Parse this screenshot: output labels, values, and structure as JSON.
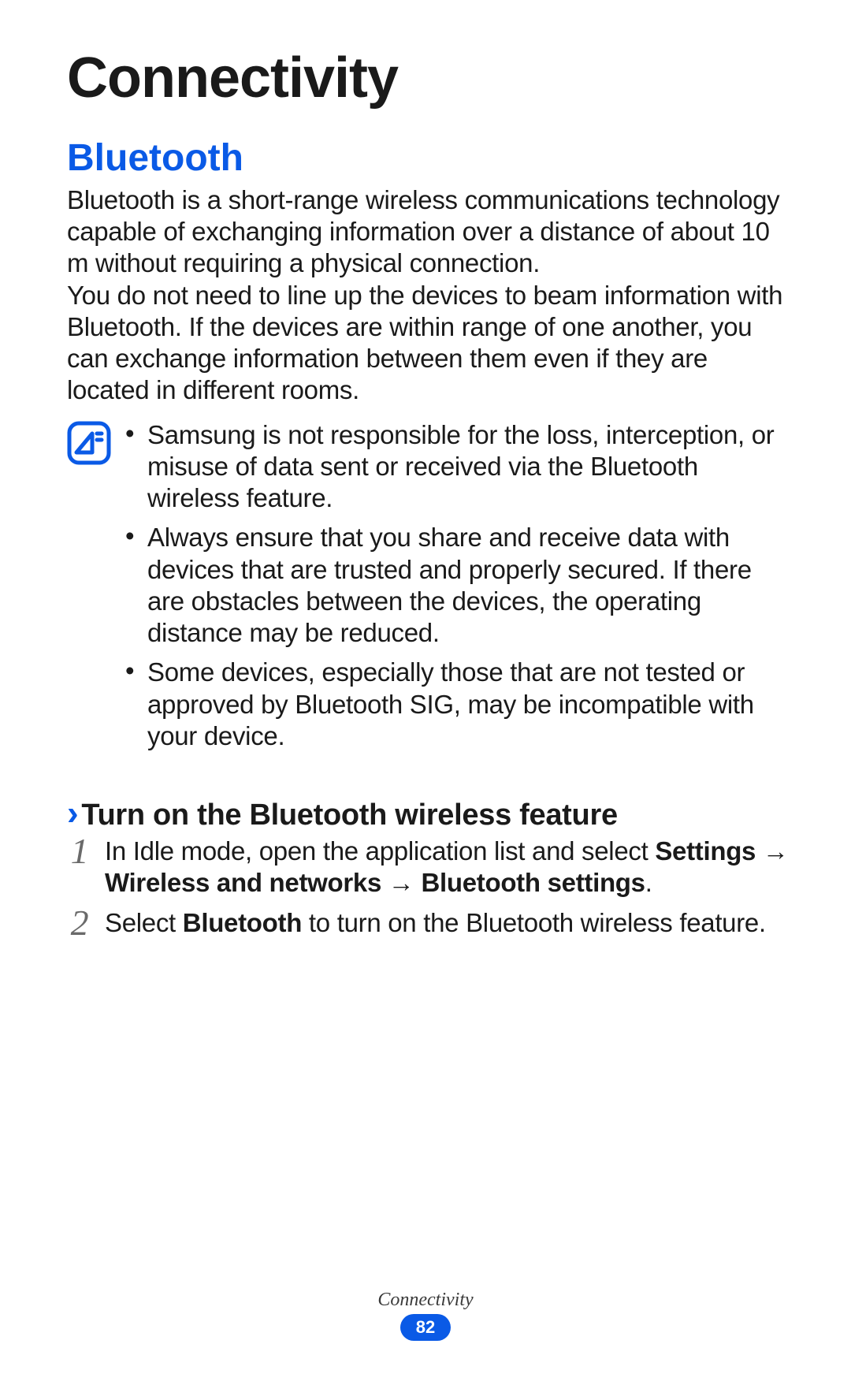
{
  "chapter": {
    "title": "Connectivity"
  },
  "section": {
    "title": "Bluetooth",
    "p1": "Bluetooth is a short-range wireless communications technology capable of exchanging information over a distance of about 10 m without requiring a physical connection.",
    "p2": "You do not need to line up the devices to beam information with Bluetooth. If the devices are within range of one another, you can exchange information between them even if they are located in different rooms."
  },
  "note": {
    "items": [
      "Samsung is not responsible for the loss, interception, or misuse of data sent or received via the Bluetooth wireless feature.",
      "Always ensure that you share and receive data with devices that are trusted and properly secured. If there are obstacles between the devices, the operating distance may be reduced.",
      "Some devices, especially those that are not tested or approved by Bluetooth SIG, may be incompatible with your device."
    ]
  },
  "subheading": {
    "text": "Turn on the Bluetooth wireless feature"
  },
  "steps": [
    {
      "num": "1",
      "pre": "In Idle mode, open the application list and select ",
      "b1": "Settings",
      "mid1": " → ",
      "b2": "Wireless and networks",
      "mid2": " → ",
      "b3": "Bluetooth settings",
      "post": "."
    },
    {
      "num": "2",
      "pre": "Select ",
      "b1": "Bluetooth",
      "post": " to turn on the Bluetooth wireless feature."
    }
  ],
  "footer": {
    "label": "Connectivity",
    "page": "82"
  }
}
